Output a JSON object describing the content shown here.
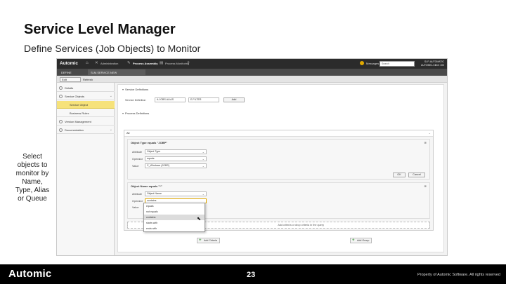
{
  "slide": {
    "title": "Service Level Manager",
    "subtitle": "Define Services (Job Objects) to Monitor",
    "side_note": "Select objects to monitor by Name, Type, Alias or Queue"
  },
  "app": {
    "logo": "Automic",
    "tabs": [
      "Administration",
      "Process Assembly",
      "Process Monitoring"
    ],
    "messages_label": "Messages",
    "search_placeholder": "Search",
    "user_line1": "SLP-AUTOMATIC",
    "user_line2": "AUTOMIC-Client 100",
    "subbar_left": "DEFINE",
    "subbar_right": "SLM.SERVICE.NEW",
    "toolbar_button": "Edit",
    "toolbar_text": "Refresh"
  },
  "sidebar": {
    "items": [
      {
        "label": "Details"
      },
      {
        "label": "Service Objects"
      },
      {
        "label": "Service Object"
      },
      {
        "label": "Business Rules"
      },
      {
        "label": "Version Management"
      },
      {
        "label": "Documentation"
      }
    ]
  },
  "main": {
    "section1": "Service Definitions",
    "service_label": "Service Definition",
    "service_value": "A.JOBS.ALIAS",
    "service_type": "E.FILTER",
    "add_label": "Add",
    "section2": "Process Definitions",
    "filter_head": "All",
    "card1": {
      "title": "Object Type equals \"JOBP\"",
      "attr_label": "Attribute",
      "attr_value": "Object Type",
      "op_label": "Operator",
      "op_value": "equals",
      "val_label": "Value",
      "val_value": "C_Windows (JOBS)",
      "ok": "OK",
      "cancel": "Cancel"
    },
    "card2": {
      "title": "Object Name equals \"*\"",
      "attr_label": "Attribute",
      "attr_value": "Object Name",
      "op_label": "Operator",
      "op_value": "contains",
      "val_label": "Value",
      "ok": "OK",
      "cancel": "Cancel"
    },
    "dropdown_options": [
      "equals",
      "not equals",
      "contains",
      "starts with",
      "ends with"
    ],
    "dropzone_text": "Add criteria or drop criteria in the query",
    "add_criteria": "Add Criteria",
    "add_group": "Add Group"
  },
  "footer": {
    "brand": "Automic",
    "page": "23",
    "copyright": "Property of Automic Software. All rights reserved"
  }
}
